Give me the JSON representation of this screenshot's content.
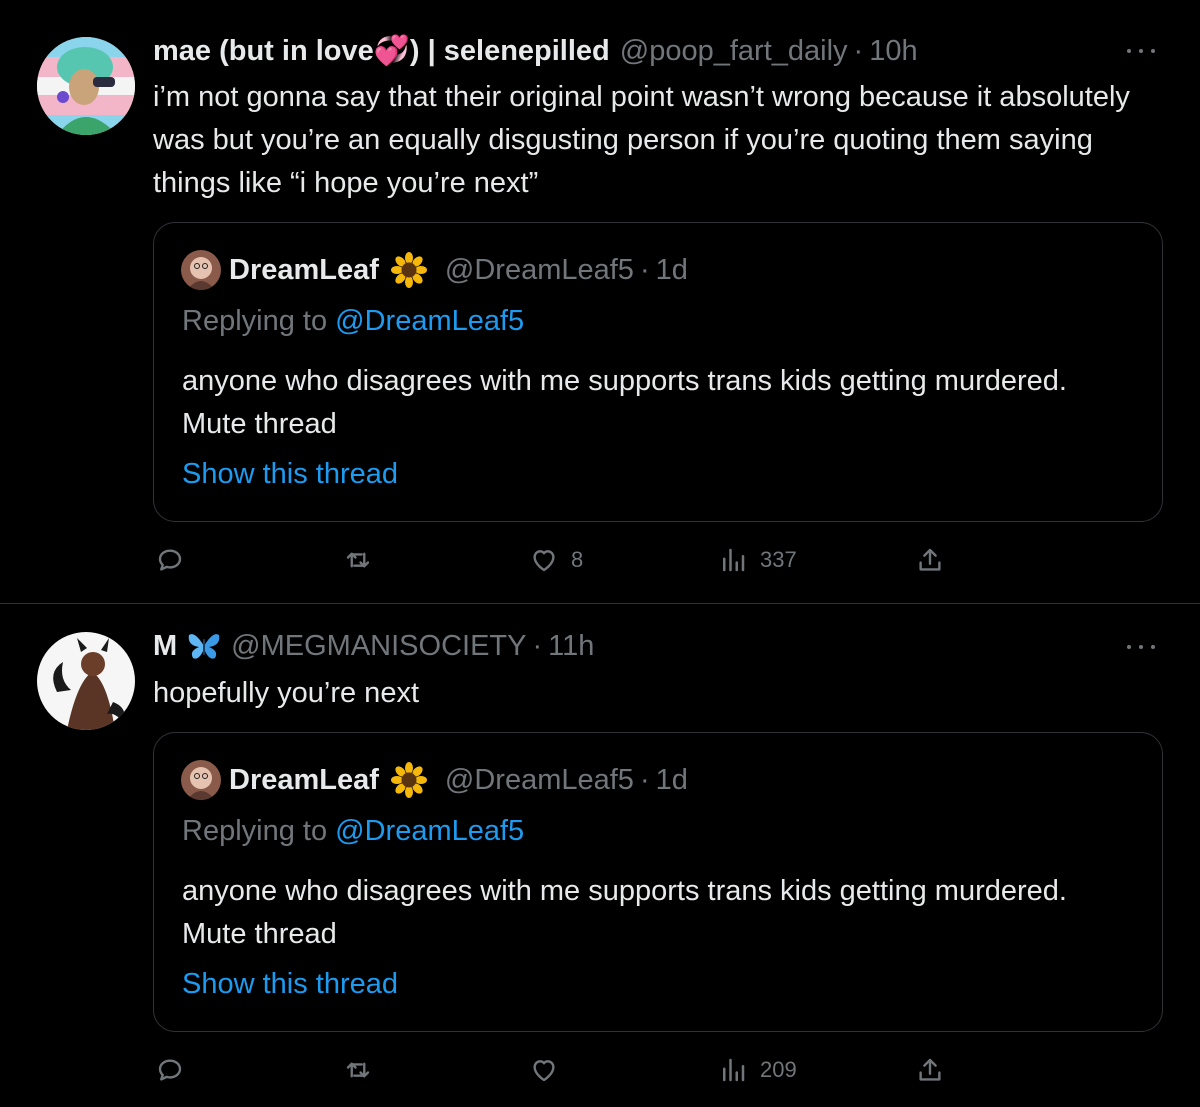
{
  "tweets": [
    {
      "author_name": "mae (but in love💞) | selenepilled",
      "handle": "@poop_fart_daily",
      "separator": "·",
      "time": "10h",
      "text": "i’m not gonna say that their original point wasn’t wrong because it absolutely was but you’re an equally disgusting person if you’re quoting them saying things like “i hope you’re next”",
      "quote": {
        "author_name": "DreamLeaf",
        "author_emoji": "sunflower-icon",
        "handle": "@DreamLeaf5",
        "separator": "·",
        "time": "1d",
        "replying_prefix": "Replying to ",
        "replying_to": "@DreamLeaf5",
        "text": "anyone who disagrees with me supports trans kids getting murdered. Mute thread",
        "show_thread": "Show this thread"
      },
      "actions": {
        "reply": "",
        "retweet": "",
        "like": "8",
        "views": "337"
      }
    },
    {
      "author_name": "M",
      "author_emoji": "butterfly-icon",
      "handle": "@MEGMANISOCIETY",
      "separator": "·",
      "time": "11h",
      "text": "hopefully you’re next",
      "quote": {
        "author_name": "DreamLeaf",
        "author_emoji": "sunflower-icon",
        "handle": "@DreamLeaf5",
        "separator": "·",
        "time": "1d",
        "replying_prefix": "Replying to ",
        "replying_to": "@DreamLeaf5",
        "text": "anyone who disagrees with me supports trans kids getting murdered. Mute thread",
        "show_thread": "Show this thread"
      },
      "actions": {
        "reply": "",
        "retweet": "",
        "like": "",
        "views": "209"
      }
    }
  ],
  "colors": {
    "background": "#000000",
    "text": "#e7e9ea",
    "secondary": "#71767b",
    "link": "#1d9bf0",
    "border": "#2f3336"
  }
}
